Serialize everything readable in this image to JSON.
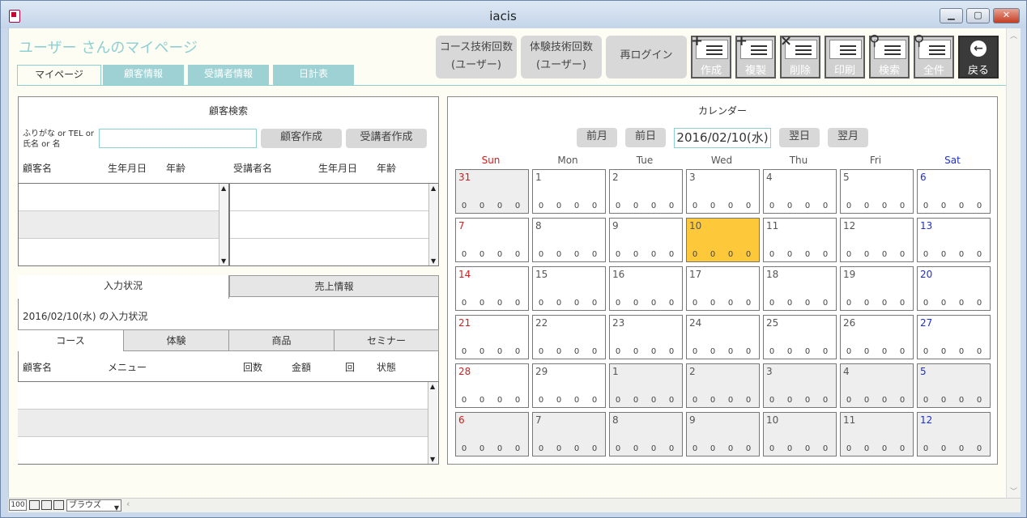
{
  "window": {
    "title": "iacis",
    "min": "▁",
    "max": "▢",
    "close": "✕"
  },
  "header": {
    "page_title": "ユーザー さんのマイページ"
  },
  "tabs": [
    {
      "label": "マイページ"
    },
    {
      "label": "顧客情報"
    },
    {
      "label": "受講者情報"
    },
    {
      "label": "日計表"
    }
  ],
  "gray_buttons": [
    {
      "line1": "コース技術回数",
      "line2": "(ユーザー)"
    },
    {
      "line1": "体験技術回数",
      "line2": "(ユーザー)"
    },
    {
      "line1": "再ログイン",
      "line2": ""
    }
  ],
  "toolbar": [
    {
      "label": "作成",
      "glyph": "+"
    },
    {
      "label": "複製",
      "glyph": "+"
    },
    {
      "label": "削除",
      "glyph": "×"
    },
    {
      "label": "印刷",
      "glyph": ""
    },
    {
      "label": "検索",
      "glyph": "⚲"
    },
    {
      "label": "全件",
      "glyph": "⚲"
    },
    {
      "label": "戻る",
      "glyph": "←"
    }
  ],
  "customer_search": {
    "title": "顧客検索",
    "hint_line1": "ふりがな or TEL or",
    "hint_line2": "氏名 or 名",
    "input_value": "",
    "create_customer": "顧客作成",
    "create_student": "受講者作成",
    "cols_left": [
      "顧客名",
      "生年月日",
      "年齢"
    ],
    "cols_right": [
      "受講者名",
      "生年月日",
      "年齢"
    ]
  },
  "input_status": {
    "tab_input": "入力状況",
    "tab_sales": "売上情報",
    "date_caption": "2016/02/10(水) の入力状況",
    "segments": [
      "コース",
      "体験",
      "商品",
      "セミナー"
    ],
    "cols": [
      "顧客名",
      "メニュー",
      "回数",
      "金額",
      "回",
      "状態"
    ]
  },
  "calendar": {
    "title": "カレンダー",
    "prev_month": "前月",
    "prev_day": "前日",
    "current_date": "2016/02/10(水)",
    "next_day": "翌日",
    "next_month": "翌月",
    "weekdays": [
      "Sun",
      "Mon",
      "Tue",
      "Wed",
      "Thu",
      "Fri",
      "Sat"
    ],
    "weeks": [
      [
        {
          "d": "31",
          "o": true
        },
        {
          "d": "1"
        },
        {
          "d": "2"
        },
        {
          "d": "3"
        },
        {
          "d": "4"
        },
        {
          "d": "5"
        },
        {
          "d": "6"
        }
      ],
      [
        {
          "d": "7"
        },
        {
          "d": "8"
        },
        {
          "d": "9"
        },
        {
          "d": "10",
          "t": true
        },
        {
          "d": "11"
        },
        {
          "d": "12"
        },
        {
          "d": "13"
        }
      ],
      [
        {
          "d": "14"
        },
        {
          "d": "15"
        },
        {
          "d": "16"
        },
        {
          "d": "17"
        },
        {
          "d": "18"
        },
        {
          "d": "19"
        },
        {
          "d": "20"
        }
      ],
      [
        {
          "d": "21"
        },
        {
          "d": "22"
        },
        {
          "d": "23"
        },
        {
          "d": "24"
        },
        {
          "d": "25"
        },
        {
          "d": "26"
        },
        {
          "d": "27"
        }
      ],
      [
        {
          "d": "28"
        },
        {
          "d": "29"
        },
        {
          "d": "1",
          "o": true
        },
        {
          "d": "2",
          "o": true
        },
        {
          "d": "3",
          "o": true
        },
        {
          "d": "4",
          "o": true
        },
        {
          "d": "5",
          "o": true
        }
      ],
      [
        {
          "d": "6",
          "o": true
        },
        {
          "d": "7",
          "o": true
        },
        {
          "d": "8",
          "o": true
        },
        {
          "d": "9",
          "o": true
        },
        {
          "d": "10",
          "o": true
        },
        {
          "d": "11",
          "o": true
        },
        {
          "d": "12",
          "o": true
        }
      ]
    ],
    "counts": [
      "0",
      "0",
      "0",
      "0"
    ]
  },
  "status": {
    "zoom": "100",
    "mode": "ブラウズ"
  },
  "colors": {
    "accent": "#8ecfd2",
    "today": "#fdc83a",
    "sunday": "#d81b1b",
    "saturday": "#1b2fd8"
  }
}
